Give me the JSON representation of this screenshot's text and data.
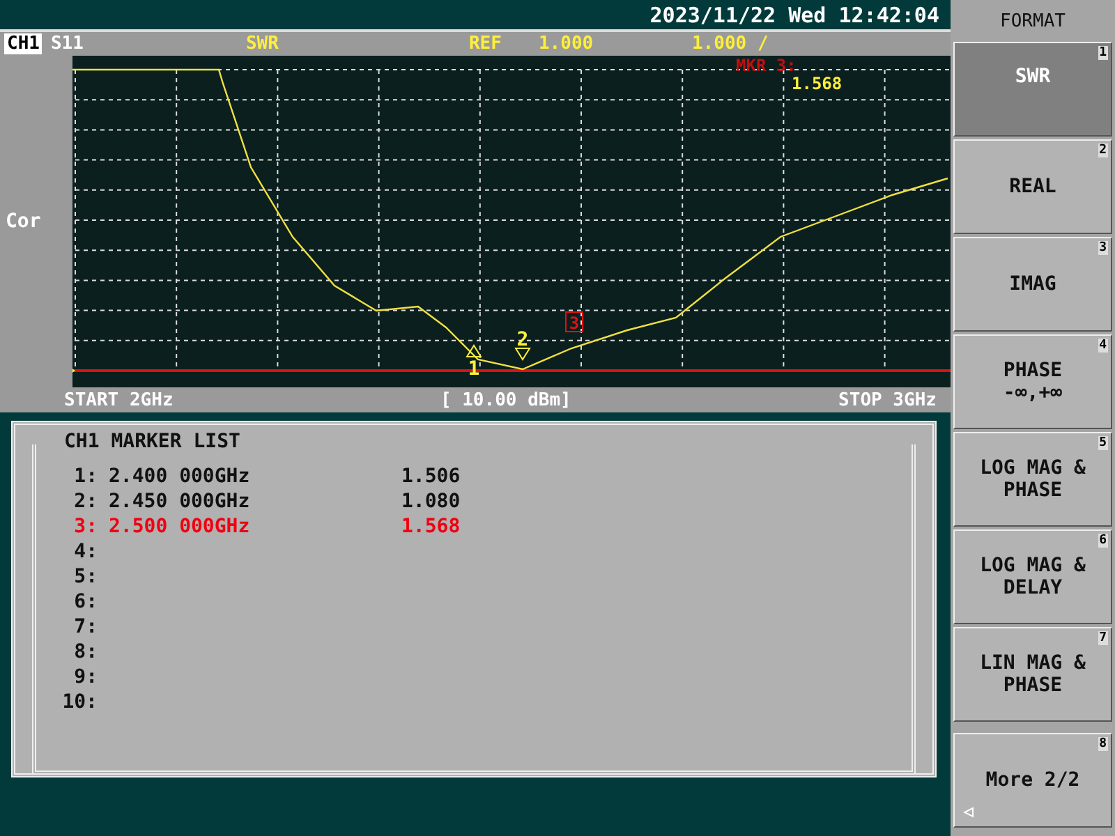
{
  "status_bar": {
    "datetime": "2023/11/22 Wed 12:42:04"
  },
  "channel_bar": {
    "channel": "CH1",
    "parameter": "S11",
    "format": "SWR",
    "ref_label": "REF",
    "ref_value": "1.000",
    "scale": "1.000 /"
  },
  "plot": {
    "side_label": "Cor",
    "marker_readout": {
      "label": "MKR 3:",
      "value": "1.568"
    },
    "markers": [
      {
        "label": "1",
        "kind": "up"
      },
      {
        "label": "2",
        "kind": "down"
      },
      {
        "label": "3",
        "kind": "active"
      }
    ],
    "start": "START 2GHz",
    "power": "[ 10.00 dBm]",
    "stop": "STOP 3GHz"
  },
  "marker_list": {
    "title": "CH1 MARKER LIST",
    "rows": [
      {
        "index": "1:",
        "frequency": "2.400 000GHz",
        "value": "1.506",
        "selected": false
      },
      {
        "index": "2:",
        "frequency": "2.450 000GHz",
        "value": "1.080",
        "selected": false
      },
      {
        "index": "3:",
        "frequency": "2.500 000GHz",
        "value": "1.568",
        "selected": true
      },
      {
        "index": "4:"
      },
      {
        "index": "5:"
      },
      {
        "index": "6:"
      },
      {
        "index": "7:"
      },
      {
        "index": "8:"
      },
      {
        "index": "9:"
      },
      {
        "index": "10:"
      }
    ]
  },
  "menu": {
    "title": "FORMAT",
    "softkeys": [
      {
        "lines": [
          "SWR"
        ],
        "number": "1",
        "selected": true
      },
      {
        "lines": [
          "REAL"
        ],
        "number": "2",
        "selected": false
      },
      {
        "lines": [
          "IMAG"
        ],
        "number": "3",
        "selected": false
      },
      {
        "lines": [
          "PHASE",
          "-∞,+∞"
        ],
        "number": "4",
        "selected": false
      },
      {
        "lines": [
          "LOG MAG &",
          "PHASE"
        ],
        "number": "5",
        "selected": false
      },
      {
        "lines": [
          "LOG MAG &",
          "DELAY"
        ],
        "number": "6",
        "selected": false
      },
      {
        "lines": [
          "LIN MAG &",
          "PHASE"
        ],
        "number": "7",
        "selected": false
      },
      {
        "lines": [
          "More 2/2"
        ],
        "number": "8",
        "selected": false,
        "kind": "more"
      }
    ]
  }
}
